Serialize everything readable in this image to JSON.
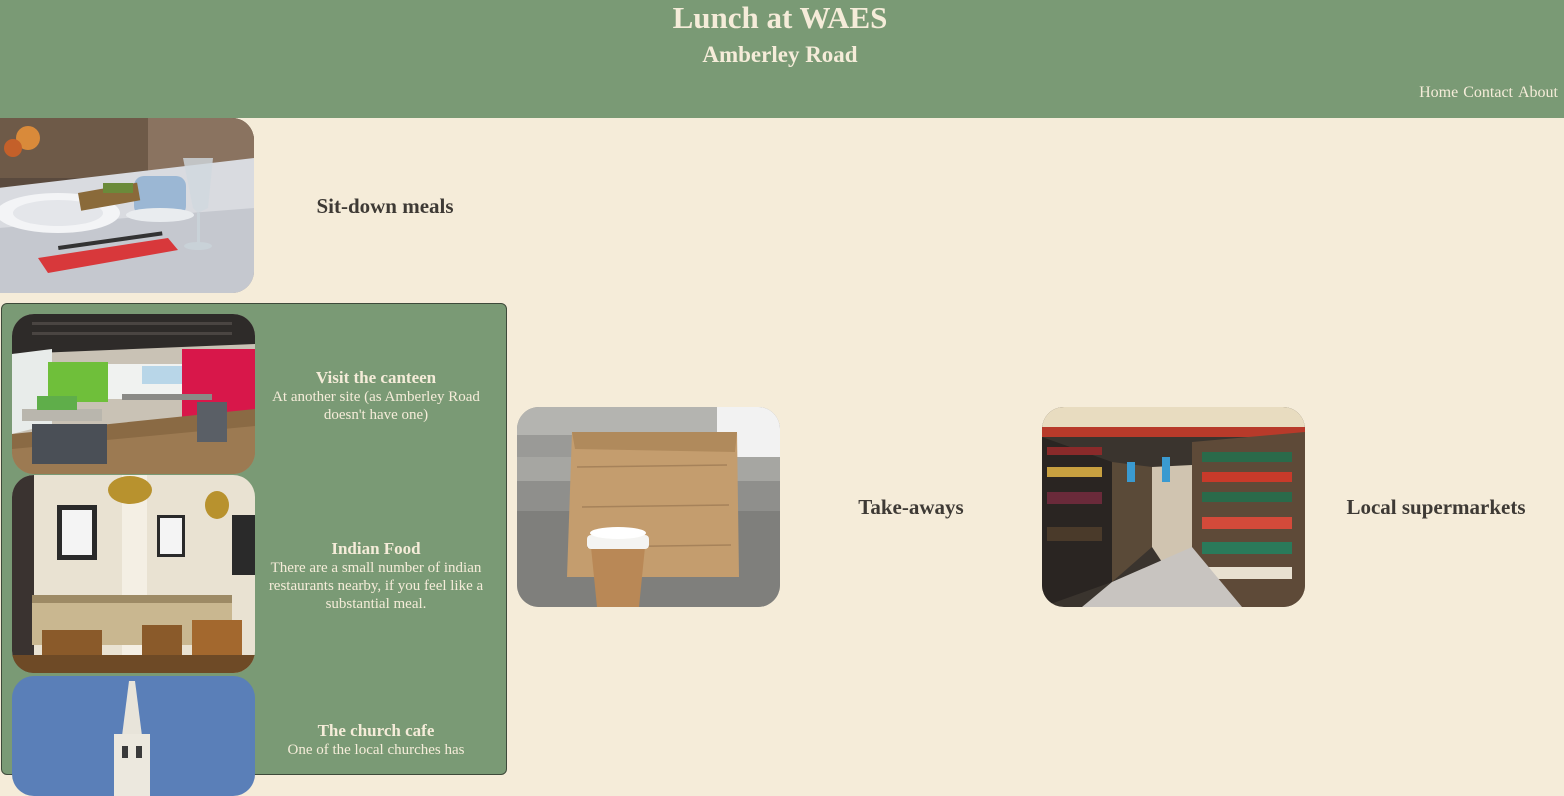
{
  "header": {
    "title": "Lunch at WAES",
    "subtitle": "Amberley Road",
    "nav": [
      "Home",
      "Contact",
      "About"
    ]
  },
  "sections": {
    "sit_down": {
      "label": "Sit-down meals",
      "image": "restaurant-table-image"
    },
    "take_aways": {
      "label": "Take-aways",
      "image": "paper-bag-coffee-image"
    },
    "supermarkets": {
      "label": "Local supermarkets",
      "image": "supermarket-aisle-image"
    }
  },
  "sit_down_options": [
    {
      "title": "Visit the canteen",
      "text": "At another site (as Amberley Road doesn't have one)",
      "image": "canteen-image"
    },
    {
      "title": "Indian Food",
      "text": "There are a small number of indian restaurants nearby, if you feel like a substantial meal.",
      "image": "indian-restaurant-image"
    },
    {
      "title": "The church cafe",
      "text": "One of the local churches has",
      "image": "church-image"
    }
  ],
  "colors": {
    "header_green": "#7a9a75",
    "background_cream": "#f5ecd9",
    "text_dark": "#3e3a35"
  }
}
